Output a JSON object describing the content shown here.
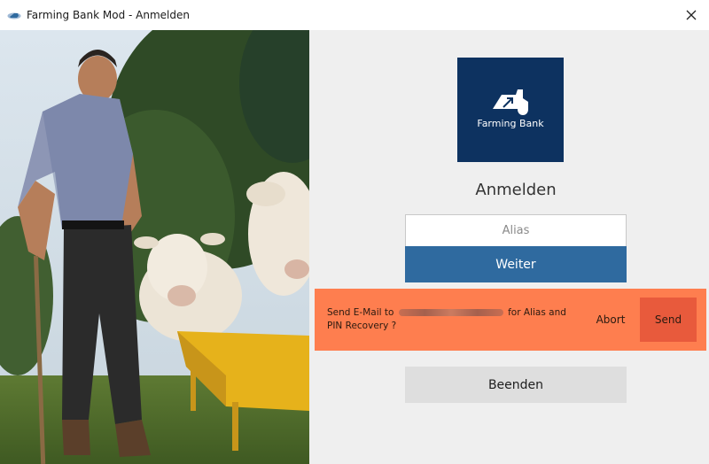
{
  "window": {
    "title": "Farming Bank Mod - Anmelden"
  },
  "logo": {
    "text": "Farming Bank",
    "tile_color": "#0d3260"
  },
  "login": {
    "heading": "Anmelden",
    "alias_placeholder": "Alias",
    "alias_value": "",
    "next_label": "Weiter",
    "quit_label": "Beenden"
  },
  "recovery_banner": {
    "text_before": "Send E-Mail to",
    "text_after": "for Alias and PIN Recovery ?",
    "abort_label": "Abort",
    "send_label": "Send",
    "banner_color": "#fe7e4f",
    "send_color": "#e85a3c"
  },
  "colors": {
    "primary": "#2f6a9f",
    "background": "#efefef"
  },
  "icons": [
    "app-icon",
    "close-icon",
    "tractor-icon"
  ]
}
